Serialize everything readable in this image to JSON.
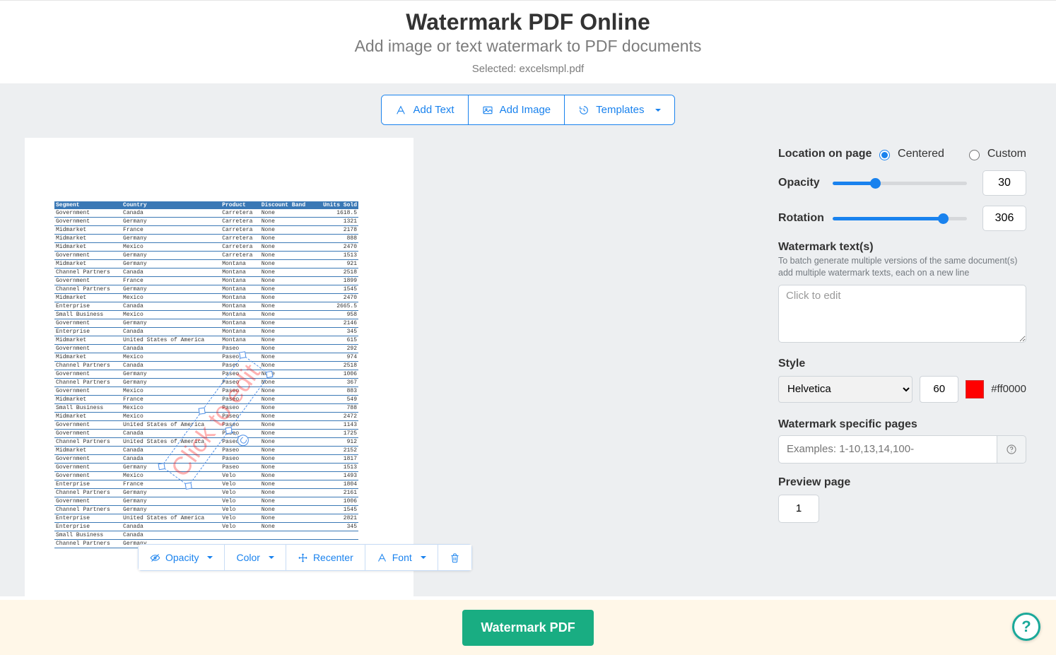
{
  "header": {
    "title": "Watermark PDF Online",
    "subtitle": "Add image or text watermark to PDF documents",
    "selected_prefix": "Selected: ",
    "selected_file": "excelsmpl.pdf"
  },
  "toolbar": {
    "add_text": "Add Text",
    "add_image": "Add Image",
    "templates": "Templates"
  },
  "preview_table": {
    "headers": [
      "Segment",
      "Country",
      "Product",
      "Discount Band",
      "Units Sold"
    ],
    "rows": [
      [
        "Government",
        "Canada",
        "Carretera",
        "None",
        "1618.5"
      ],
      [
        "Government",
        "Germany",
        "Carretera",
        "None",
        "1321"
      ],
      [
        "Midmarket",
        "France",
        "Carretera",
        "None",
        "2178"
      ],
      [
        "Midmarket",
        "Germany",
        "Carretera",
        "None",
        "888"
      ],
      [
        "Midmarket",
        "Mexico",
        "Carretera",
        "None",
        "2470"
      ],
      [
        "Government",
        "Germany",
        "Carretera",
        "None",
        "1513"
      ],
      [
        "Midmarket",
        "Germany",
        "Montana",
        "None",
        "921"
      ],
      [
        "Channel Partners",
        "Canada",
        "Montana",
        "None",
        "2518"
      ],
      [
        "Government",
        "France",
        "Montana",
        "None",
        "1899"
      ],
      [
        "Channel Partners",
        "Germany",
        "Montana",
        "None",
        "1545"
      ],
      [
        "Midmarket",
        "Mexico",
        "Montana",
        "None",
        "2470"
      ],
      [
        "Enterprise",
        "Canada",
        "Montana",
        "None",
        "2665.5"
      ],
      [
        "Small Business",
        "Mexico",
        "Montana",
        "None",
        "958"
      ],
      [
        "Government",
        "Germany",
        "Montana",
        "None",
        "2146"
      ],
      [
        "Enterprise",
        "Canada",
        "Montana",
        "None",
        "345"
      ],
      [
        "Midmarket",
        "United States of America",
        "Montana",
        "None",
        "615"
      ],
      [
        "Government",
        "Canada",
        "Paseo",
        "None",
        "292"
      ],
      [
        "Midmarket",
        "Mexico",
        "Paseo",
        "None",
        "974"
      ],
      [
        "Channel Partners",
        "Canada",
        "Paseo",
        "None",
        "2518"
      ],
      [
        "Government",
        "Germany",
        "Paseo",
        "None",
        "1006"
      ],
      [
        "Channel Partners",
        "Germany",
        "Paseo",
        "None",
        "367"
      ],
      [
        "Government",
        "Mexico",
        "Paseo",
        "None",
        "883"
      ],
      [
        "Midmarket",
        "France",
        "Paseo",
        "None",
        "549"
      ],
      [
        "Small Business",
        "Mexico",
        "Paseo",
        "None",
        "788"
      ],
      [
        "Midmarket",
        "Mexico",
        "Paseo",
        "None",
        "2472"
      ],
      [
        "Government",
        "United States of America",
        "Paseo",
        "None",
        "1143"
      ],
      [
        "Government",
        "Canada",
        "Paseo",
        "None",
        "1725"
      ],
      [
        "Channel Partners",
        "United States of America",
        "Paseo",
        "None",
        "912"
      ],
      [
        "Midmarket",
        "Canada",
        "Paseo",
        "None",
        "2152"
      ],
      [
        "Government",
        "Canada",
        "Paseo",
        "None",
        "1817"
      ],
      [
        "Government",
        "Germany",
        "Paseo",
        "None",
        "1513"
      ],
      [
        "Government",
        "Mexico",
        "Velo",
        "None",
        "1493"
      ],
      [
        "Enterprise",
        "France",
        "Velo",
        "None",
        "1804"
      ],
      [
        "Channel Partners",
        "Germany",
        "Velo",
        "None",
        "2161"
      ],
      [
        "Government",
        "Germany",
        "Velo",
        "None",
        "1006"
      ],
      [
        "Channel Partners",
        "Germany",
        "Velo",
        "None",
        "1545"
      ],
      [
        "Enterprise",
        "United States of America",
        "Velo",
        "None",
        "2821"
      ],
      [
        "Enterprise",
        "Canada",
        "Velo",
        "None",
        "345"
      ],
      [
        "Small Business",
        "Canada",
        "",
        "",
        ""
      ],
      [
        "Channel Partners",
        "Germany",
        "",
        "",
        ""
      ]
    ]
  },
  "watermark_overlay": {
    "text": "Click to edit"
  },
  "mini_toolbar": {
    "opacity": "Opacity",
    "color": "Color",
    "recenter": "Recenter",
    "font": "Font"
  },
  "sidebar": {
    "location_label": "Location on page",
    "location_centered": "Centered",
    "location_custom": "Custom",
    "opacity_label": "Opacity",
    "opacity_value": "30",
    "rotation_label": "Rotation",
    "rotation_value": "306",
    "texts_label": "Watermark text(s)",
    "texts_hint": "To batch generate multiple versions of the same document(s) add multiple watermark texts, each on a new line",
    "texts_value": "Click to edit",
    "style_label": "Style",
    "font_family": "Helvetica",
    "font_size": "60",
    "color_hex": "#ff0000",
    "pages_label": "Watermark specific pages",
    "pages_placeholder": "Examples: 1-10,13,14,100-",
    "preview_label": "Preview page",
    "preview_value": "1"
  },
  "action": {
    "submit": "Watermark PDF"
  },
  "slider_bg": {
    "opacity_pct": 30,
    "rotation_pct": 85
  }
}
